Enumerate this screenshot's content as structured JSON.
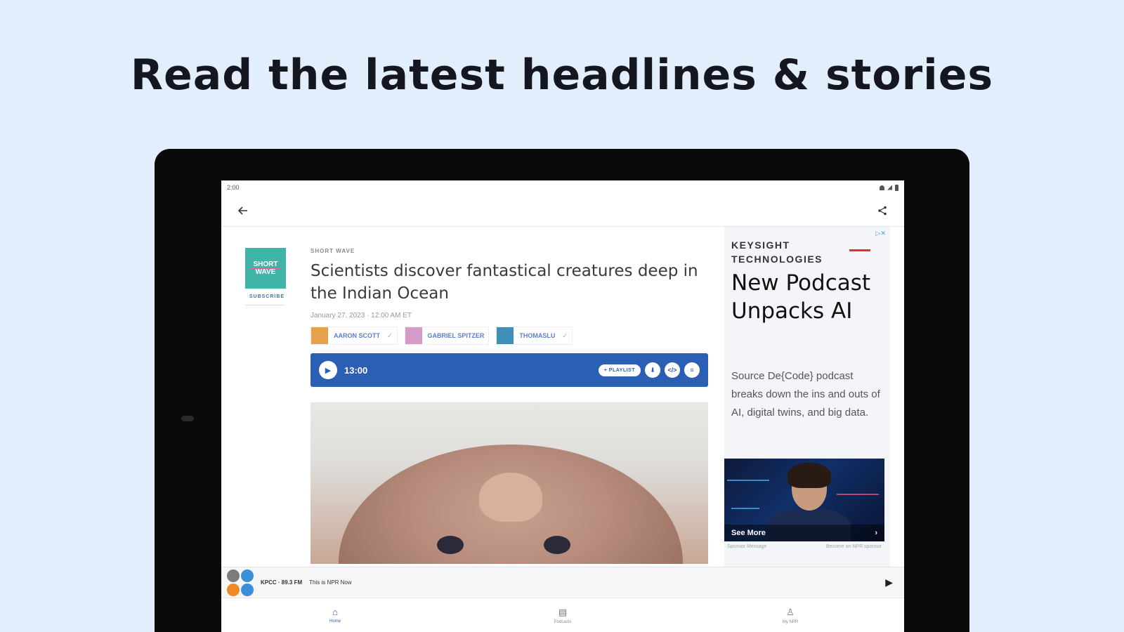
{
  "promo": {
    "headline": "Read the latest headlines & stories"
  },
  "statusbar": {
    "time": "2:00"
  },
  "topbar": {
    "back_icon": "arrow-left-icon",
    "share_icon": "share-icon"
  },
  "show": {
    "logo_text": "SHORT WAVE",
    "subscribe_label": "SUBSCRIBE"
  },
  "article": {
    "kicker": "SHORT WAVE",
    "title": "Scientists discover fantastical creatures deep in the Indian Ocean",
    "dateline": "January 27, 2023 · 12:00 AM ET",
    "authors": [
      {
        "name": "AARON SCOTT",
        "color": "#e8a04a"
      },
      {
        "name": "GABRIEL SPITZER",
        "color": "#d69ac9"
      },
      {
        "name": "THOMASLU",
        "color": "#3e8fb8"
      }
    ]
  },
  "player": {
    "duration": "13:00",
    "playlist_label": "+ PLAYLIST",
    "download_icon": "download-icon",
    "transcript_label": "</>",
    "more_icon": "more-icon"
  },
  "ad": {
    "choice": "▷✕",
    "brand_line1": "KEYSIGHT",
    "brand_line2": "TECHNOLOGIES",
    "heading": "New Podcast Unpacks AI",
    "body": "Source De{Code} podcast breaks down the ins and outs of AI, digital twins, and big data.",
    "see_more": "See More",
    "foot_left": "Sponsor Message",
    "foot_right": "Become an NPR sponsor"
  },
  "miniplayer": {
    "station": "KPCC · 89.3 FM",
    "show": "This is NPR Now"
  },
  "nav": [
    {
      "label": "Home",
      "icon": "home-icon",
      "glyph": "⌂",
      "active": true
    },
    {
      "label": "Podcasts",
      "icon": "podcasts-icon",
      "glyph": "▤",
      "active": false
    },
    {
      "label": "My NPR",
      "icon": "person-icon",
      "glyph": "♙",
      "active": false
    }
  ],
  "colors": {
    "background": "#e3eefc",
    "accent": "#2a5fb3",
    "logo_teal": "#3fb5a8"
  }
}
